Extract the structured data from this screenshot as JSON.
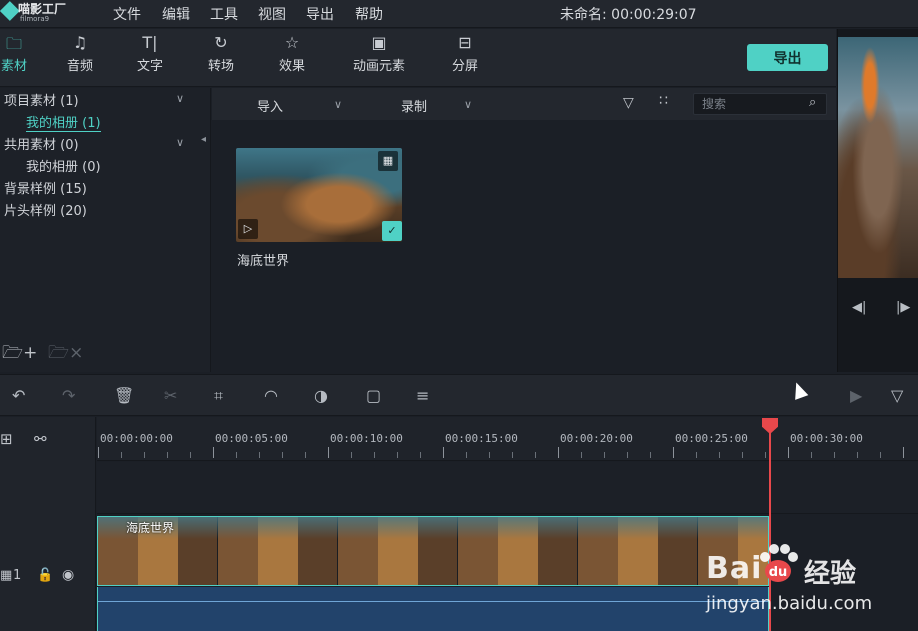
{
  "app": {
    "logo_text": "喵影工厂",
    "logo_sub": "filmora9",
    "project_title": "未命名: 00:00:29:07"
  },
  "menu": [
    "文件",
    "编辑",
    "工具",
    "视图",
    "导出",
    "帮助"
  ],
  "tabs": [
    {
      "label": "素材",
      "icon": "folder-icon",
      "active": true
    },
    {
      "label": "音频",
      "icon": "music-note-icon"
    },
    {
      "label": "文字",
      "icon": "text-icon"
    },
    {
      "label": "转场",
      "icon": "transition-icon"
    },
    {
      "label": "效果",
      "icon": "effects-icon"
    },
    {
      "label": "动画元素",
      "icon": "image-icon"
    },
    {
      "label": "分屏",
      "icon": "split-screen-icon"
    }
  ],
  "export_label": "导出",
  "library": {
    "items": [
      {
        "label": "项目素材 (1)"
      },
      {
        "label": "我的相册 (1)",
        "selected": true
      },
      {
        "label": "共用素材 (0)"
      },
      {
        "label": "我的相册 (0)"
      },
      {
        "label": "背景样例 (15)"
      },
      {
        "label": "片头样例 (20)"
      }
    ]
  },
  "media_toolbar": {
    "import_label": "导入",
    "record_label": "录制",
    "search_placeholder": "搜索"
  },
  "clip": {
    "name": "海底世界"
  },
  "timeline": {
    "timecodes": [
      "00:00:00:00",
      "00:00:05:00",
      "00:00:10:00",
      "00:00:15:00",
      "00:00:20:00",
      "00:00:25:00",
      "00:00:30:00"
    ],
    "track_number": "1",
    "clip_title": "海底世界"
  },
  "watermark": {
    "brand": "Bai",
    "brand2": "经验",
    "url": "jingyan.baidu.com"
  },
  "colors": {
    "accent": "#4fd1c5",
    "playhead": "#e8484b"
  }
}
